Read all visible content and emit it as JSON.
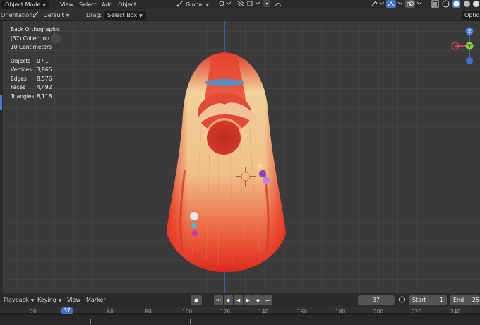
{
  "header": {
    "mode": "Object Mode",
    "menu": [
      "View",
      "Select",
      "Add",
      "Object"
    ],
    "transform_orientation": "Global",
    "options_label": "Option"
  },
  "tool_settings": {
    "orientation_label": "Orientation:",
    "orientation_value": "Default",
    "drag_label": "Drag:",
    "drag_value": "Select Box"
  },
  "viewport": {
    "view_name": "Back Orthographic",
    "collection": "(37) Collection |",
    "scale": "10 Centimeters",
    "stats": [
      {
        "label": "Objects",
        "value": "0 / 1"
      },
      {
        "label": "Vertices",
        "value": "3,865"
      },
      {
        "label": "Edges",
        "value": "8,576"
      },
      {
        "label": "Faces",
        "value": "4,492"
      },
      {
        "label": "Triangles",
        "value": "8,118"
      }
    ],
    "gizmo": {
      "z": "Z",
      "y": "Y",
      "x_color": "#e04a5a",
      "y_color": "#8ccc3a",
      "z_color": "#4d7fe0"
    }
  },
  "timeline": {
    "menu": [
      "Playback",
      "Keying",
      "View",
      "Marker"
    ],
    "current_frame": "37",
    "start_label": "Start",
    "start_value": "1",
    "end_label": "End",
    "end_value": "25",
    "ruler": [
      "20",
      "37",
      "60",
      "80",
      "100",
      "120",
      "140",
      "160",
      "180",
      "200",
      "220",
      "240"
    ]
  },
  "colors": {
    "accent": "#4672c4",
    "hair_red": "#e5392b",
    "hair_blonde": "#efcf92",
    "band": "#5b8fc0"
  }
}
